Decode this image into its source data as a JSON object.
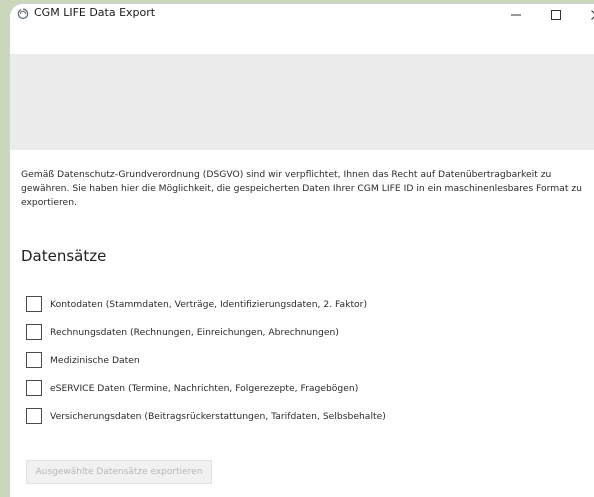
{
  "window": {
    "title": "CGM LIFE Data Export",
    "icon": "cgm-life-icon",
    "minimize_glyph": "—",
    "maximize_glyph": "☐",
    "close_glyph": "✕"
  },
  "intro_text": "Gemäß Datenschutz-Grundverordnung (DSGVO) sind wir verpflichtet, Ihnen das Recht auf Datenübertragbarkeit zu gewähren. Sie haben hier die Möglichkeit, die gespeicherten Daten Ihrer CGM LIFE ID in ein maschinenlesbares Format zu exportieren.",
  "section_title": "Datensätze",
  "options": [
    {
      "label": "Kontodaten (Stammdaten, Verträge, Identifizierungsdaten, 2. Faktor)",
      "checked": false
    },
    {
      "label": "Rechnungsdaten (Rechnungen, Einreichungen, Abrechnungen)",
      "checked": false
    },
    {
      "label": "Medizinische Daten",
      "checked": false
    },
    {
      "label": "eSERVICE Daten (Termine, Nachrichten, Folgerezepte, Fragebögen)",
      "checked": false
    },
    {
      "label": "Versicherungsdaten (Beitragsrückerstattungen, Tarifdaten, Selbsbehalte)",
      "checked": false
    }
  ],
  "export_button_label": "Ausgewählte Datensätze exportieren",
  "colors": {
    "background": "#c9d7bb",
    "banner": "#ececec",
    "button_disabled_text": "#b7b7b7"
  }
}
